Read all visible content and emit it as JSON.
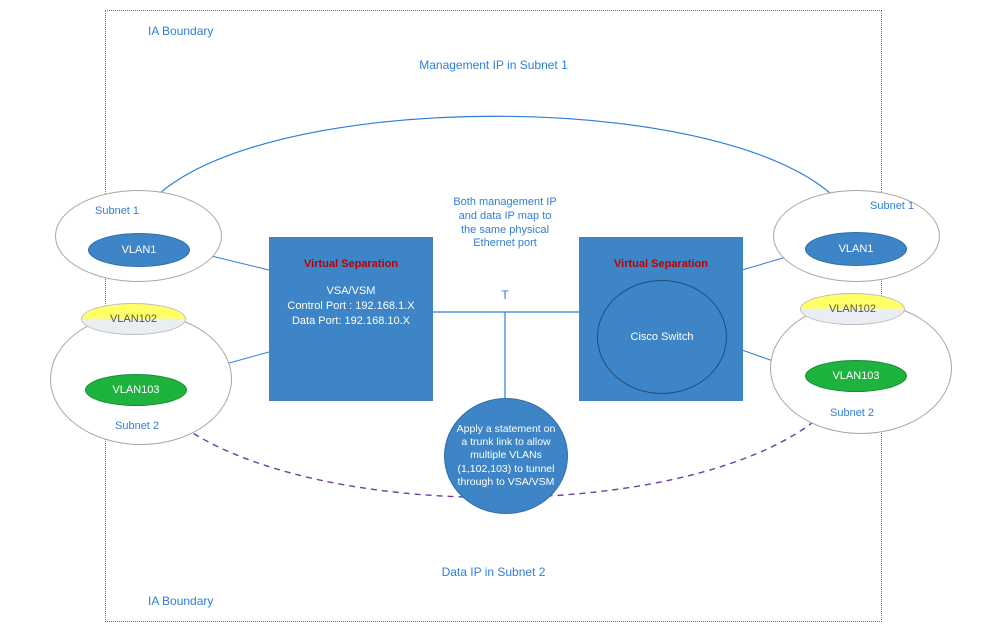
{
  "boundary": {
    "top_label": "IA Boundary",
    "bottom_label": "IA Boundary"
  },
  "titles": {
    "top": "Management IP in Subnet 1",
    "bottom": "Data IP in Subnet 2"
  },
  "center_note": {
    "line1": "Both management IP",
    "line2": "and data IP map to",
    "line3": "the same physical",
    "line4": "Ethernet port"
  },
  "trunk": {
    "marker": "T",
    "text": "Apply a statement on a trunk link to allow multiple VLANs (1,102,103) to tunnel through to VSA/VSM"
  },
  "left_box": {
    "virtual_separation": "Virtual  Separation",
    "line1": "VSA/VSM",
    "line2": "Control Port : 192.168.1.X",
    "line3": "Data Port: 192.168.10.X"
  },
  "right_box": {
    "virtual_separation": "Virtual Separation",
    "line1": "Cisco Switch"
  },
  "subnets": {
    "left_top": "Subnet 1",
    "left_bottom": "Subnet 2",
    "right_top": "Subnet 1",
    "right_bottom": "Subnet 2"
  },
  "vlans": {
    "vlan1": "VLAN1",
    "vlan102": "VLAN102",
    "vlan103": "VLAN103"
  }
}
